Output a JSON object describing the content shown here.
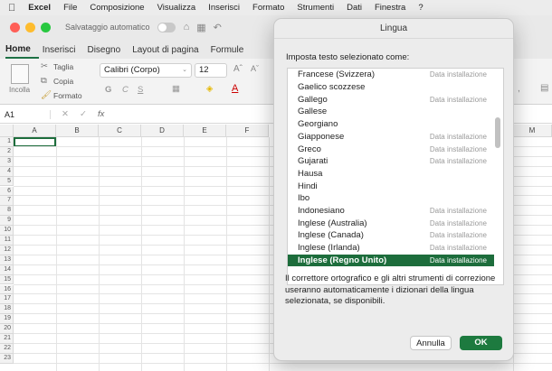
{
  "menubar": {
    "apple": "",
    "items": [
      "Excel",
      "File",
      "Composizione",
      "Visualizza",
      "Inserisci",
      "Formato",
      "Strumenti",
      "Dati",
      "Finestra",
      "?"
    ]
  },
  "titlebar": {
    "autosave": "Salvataggio automatico"
  },
  "ribbon_tabs": [
    "Home",
    "Inserisci",
    "Disegno",
    "Layout di pagina",
    "Formule"
  ],
  "ribbon": {
    "paste": "Incolla",
    "cut": "Taglia",
    "copy": "Copia",
    "format": "Formato",
    "font_name": "Calibri (Corpo)",
    "font_size": "12",
    "bold": "G",
    "italic": "C",
    "underline": "S"
  },
  "formula_bar": {
    "cell_ref": "A1",
    "fx": "fx"
  },
  "columns": [
    "A",
    "B",
    "C",
    "D",
    "E",
    "F",
    "M"
  ],
  "rows": [
    "1",
    "2",
    "3",
    "4",
    "5",
    "6",
    "7",
    "8",
    "9",
    "10",
    "11",
    "12",
    "13",
    "14",
    "15",
    "16",
    "17",
    "18",
    "19",
    "20",
    "21",
    "22",
    "23"
  ],
  "dialog": {
    "title": "Lingua",
    "prompt": "Imposta testo selezionato come:",
    "languages": [
      {
        "name": "Francese (Svizzera)",
        "status": "Data installazione"
      },
      {
        "name": "Gaelico scozzese",
        "status": ""
      },
      {
        "name": "Gallego",
        "status": "Data installazione"
      },
      {
        "name": "Gallese",
        "status": ""
      },
      {
        "name": "Georgiano",
        "status": ""
      },
      {
        "name": "Giapponese",
        "status": "Data installazione"
      },
      {
        "name": "Greco",
        "status": "Data installazione"
      },
      {
        "name": "Gujarati",
        "status": "Data installazione"
      },
      {
        "name": "Hausa",
        "status": ""
      },
      {
        "name": "Hindi",
        "status": ""
      },
      {
        "name": "Ibo",
        "status": ""
      },
      {
        "name": "Indonesiano",
        "status": "Data installazione"
      },
      {
        "name": "Inglese (Australia)",
        "status": "Data installazione"
      },
      {
        "name": "Inglese (Canada)",
        "status": "Data installazione"
      },
      {
        "name": "Inglese (Irlanda)",
        "status": "Data installazione"
      },
      {
        "name": "Inglese (Regno Unito)",
        "status": "Data installazione",
        "selected": true
      }
    ],
    "description": "Il correttore ortografico e gli altri strumenti di correzione useranno automaticamente i dizionari della lingua selezionata, se disponibili.",
    "cancel": "Annulla",
    "ok": "OK"
  },
  "colors": {
    "excel_green": "#1d6d3c",
    "ok_green": "#1d7a3f"
  }
}
